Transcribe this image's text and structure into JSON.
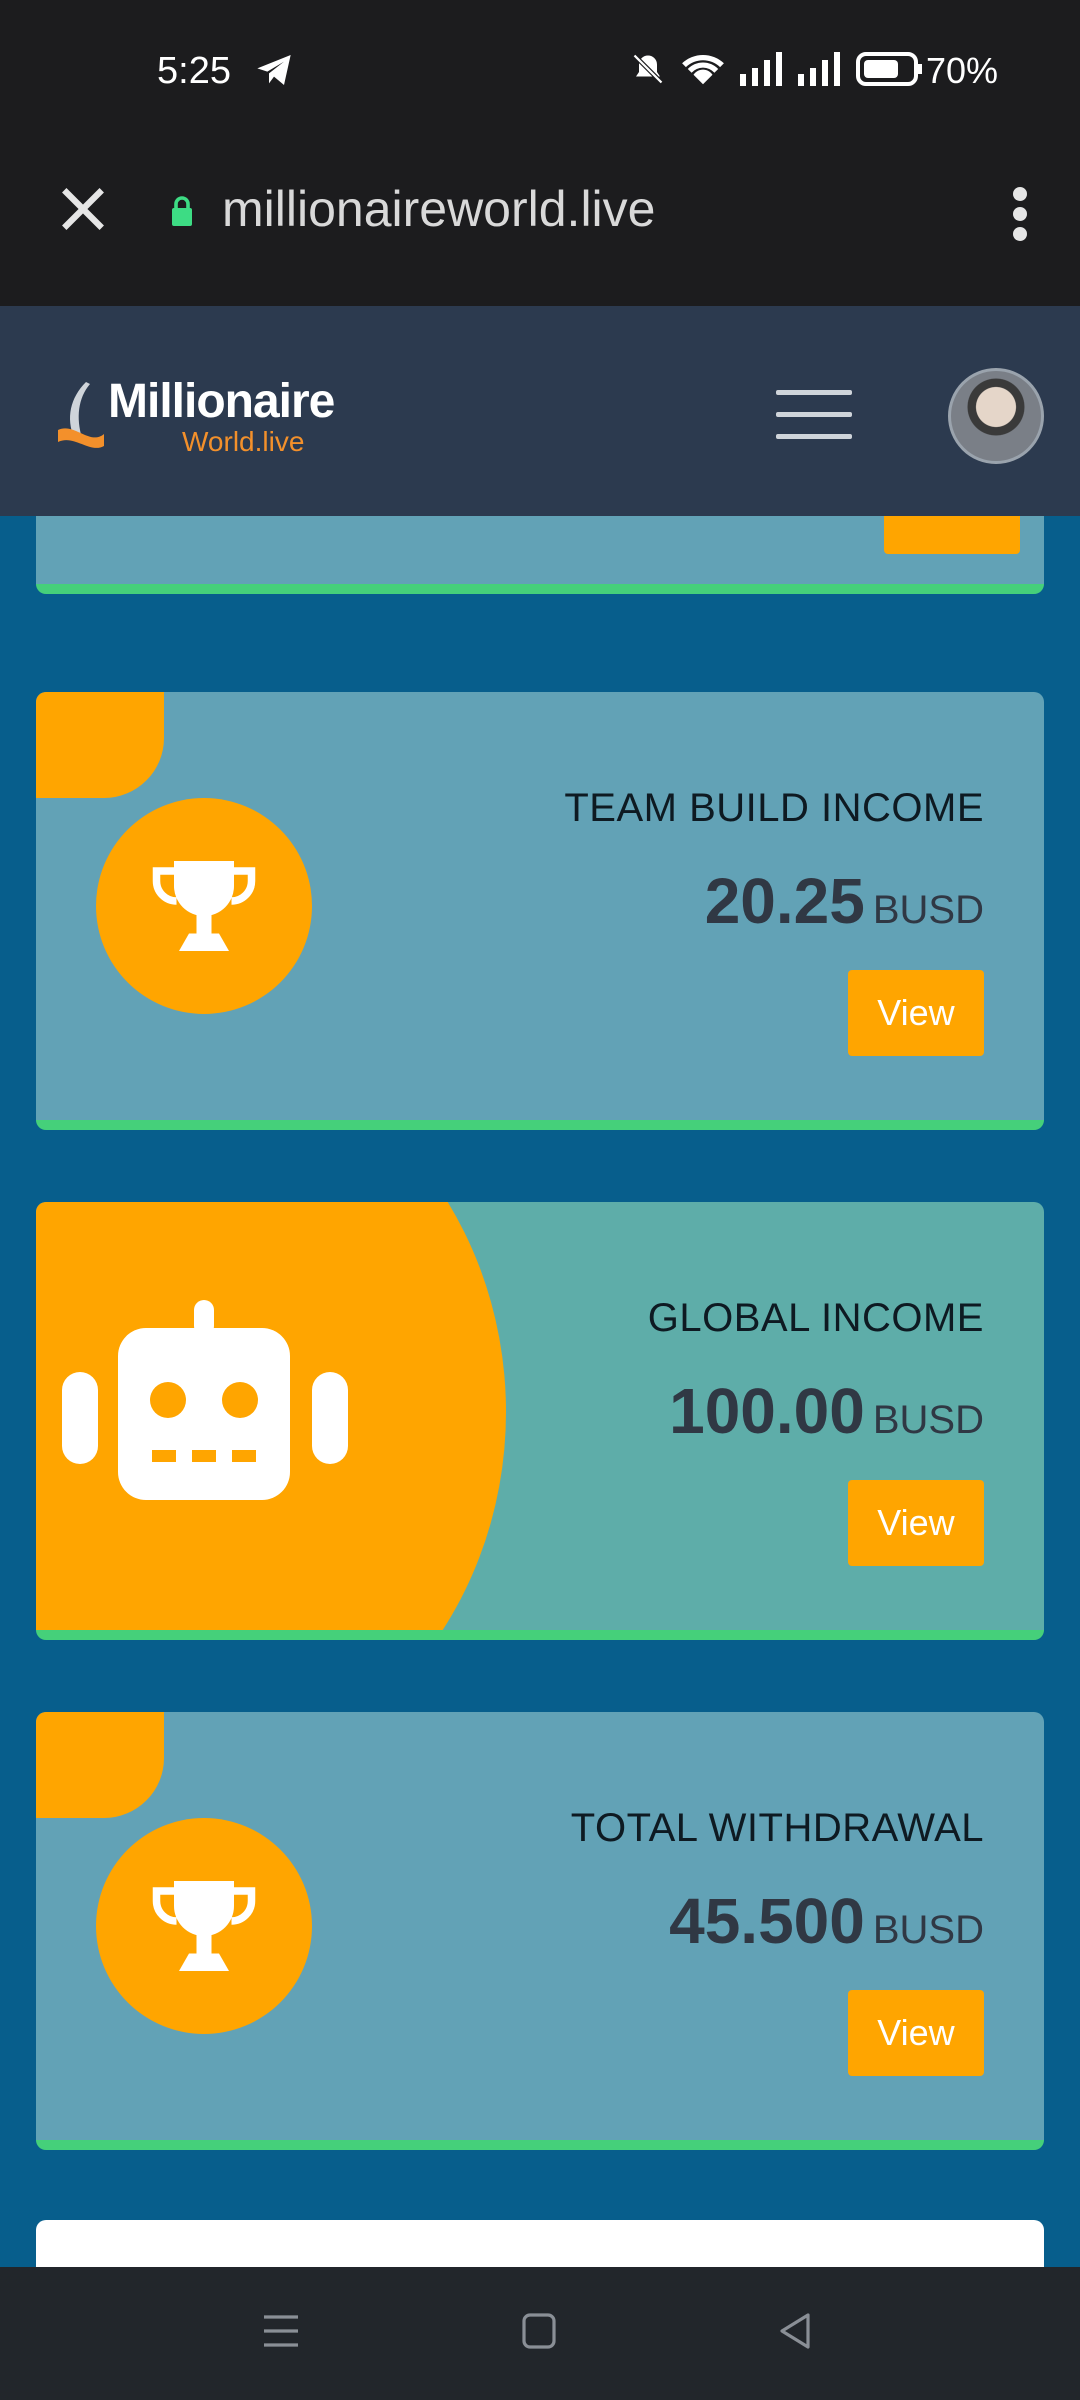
{
  "status_bar": {
    "time": "5:25",
    "battery": "70%"
  },
  "browser": {
    "url": "millionaireworld.live"
  },
  "header": {
    "logo_line1": "Millionaire",
    "logo_line2": "World.live"
  },
  "cards": [
    {
      "label": "TEAM BUILD INCOME",
      "amount": "20.25",
      "currency": "BUSD",
      "button": "View",
      "icon": "trophy-icon"
    },
    {
      "label": "GLOBAL INCOME",
      "amount": "100.00",
      "currency": "BUSD",
      "button": "View",
      "icon": "robot-icon"
    },
    {
      "label": "TOTAL WITHDRAWAL",
      "amount": "45.500",
      "currency": "BUSD",
      "button": "View",
      "icon": "trophy-icon"
    }
  ],
  "colors": {
    "accent": "#ffa500",
    "card_bg": "#62a2b6",
    "card_alt_bg": "#5eada9",
    "card_border": "#45d07a",
    "page_bg": "#075e8c"
  }
}
